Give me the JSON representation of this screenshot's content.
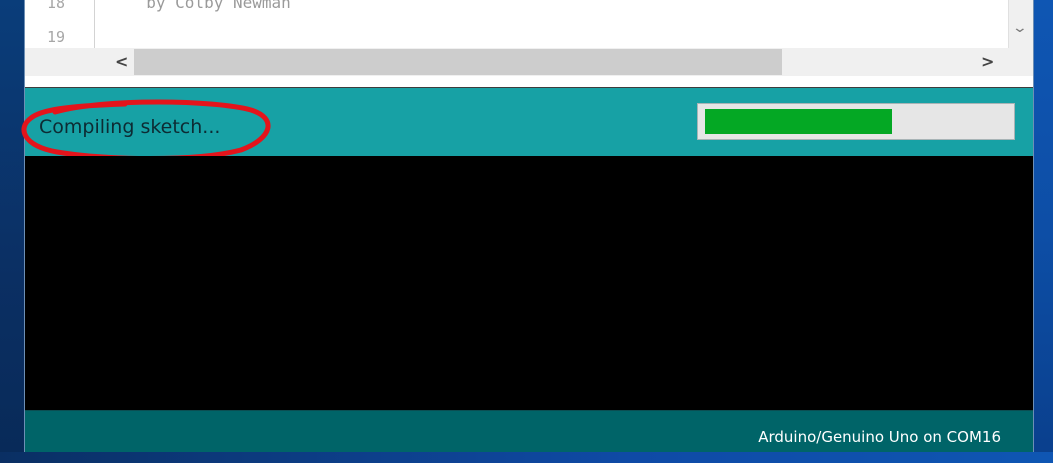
{
  "editor": {
    "line_numbers": [
      "18",
      "19"
    ],
    "code_line": "  by Colby Newman"
  },
  "scrollbars": {
    "vertical_arrow": "⌄",
    "left_arrow": "<",
    "right_arrow": ">"
  },
  "status": {
    "message": "Compiling sketch...",
    "progress_fraction": 0.62,
    "progress_color": "#04a824",
    "bar_color": "#17a1a5"
  },
  "annotation": {
    "color": "#e4141b"
  },
  "console": {
    "background": "#000000"
  },
  "footer": {
    "board_port": "Arduino/Genuino Uno on COM16",
    "background": "#006468"
  }
}
